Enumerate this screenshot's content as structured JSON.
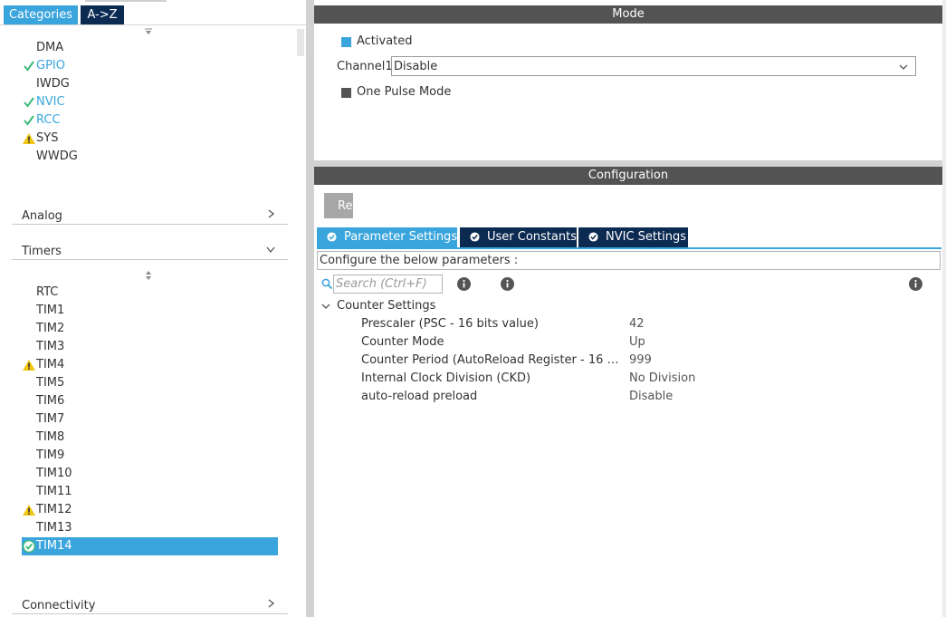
{
  "left": {
    "tabs": {
      "categories": "Categories",
      "az": "A->Z"
    },
    "system_items": [
      {
        "label": "DMA",
        "status": "none"
      },
      {
        "label": "GPIO",
        "status": "ok"
      },
      {
        "label": "IWDG",
        "status": "none"
      },
      {
        "label": "NVIC",
        "status": "ok"
      },
      {
        "label": "RCC",
        "status": "ok"
      },
      {
        "label": "SYS",
        "status": "warning"
      },
      {
        "label": "WWDG",
        "status": "none"
      }
    ],
    "sections": {
      "analog": "Analog",
      "timers": "Timers",
      "connectivity": "Connectivity"
    },
    "timer_items": [
      {
        "label": "RTC",
        "status": "none"
      },
      {
        "label": "TIM1",
        "status": "none"
      },
      {
        "label": "TIM2",
        "status": "none"
      },
      {
        "label": "TIM3",
        "status": "none"
      },
      {
        "label": "TIM4",
        "status": "warning"
      },
      {
        "label": "TIM5",
        "status": "none"
      },
      {
        "label": "TIM6",
        "status": "none"
      },
      {
        "label": "TIM7",
        "status": "none"
      },
      {
        "label": "TIM8",
        "status": "none"
      },
      {
        "label": "TIM9",
        "status": "none"
      },
      {
        "label": "TIM10",
        "status": "none"
      },
      {
        "label": "TIM11",
        "status": "none"
      },
      {
        "label": "TIM12",
        "status": "warning"
      },
      {
        "label": "TIM13",
        "status": "none"
      },
      {
        "label": "TIM14",
        "status": "selected-ok"
      }
    ]
  },
  "mode": {
    "header": "Mode",
    "activated_label": "Activated",
    "channel_label": "Channel1",
    "channel_value": "Disable",
    "one_pulse_label": "One Pulse Mode"
  },
  "config": {
    "header": "Configuration",
    "reset_button": "Re",
    "tabs": {
      "param": "Parameter Settings",
      "user": "User Constants",
      "nvic": "NVIC Settings"
    },
    "configure_label": "Configure the below parameters :",
    "search_placeholder": "Search (Ctrl+F)",
    "group_label": "Counter Settings",
    "params": [
      {
        "name": "Prescaler (PSC - 16 bits value)",
        "value": "42"
      },
      {
        "name": "Counter Mode",
        "value": "Up"
      },
      {
        "name": "Counter Period (AutoReload Register - 16 bits ...",
        "value": "999"
      },
      {
        "name": "Internal Clock Division (CKD)",
        "value": "No Division"
      },
      {
        "name": "auto-reload preload",
        "value": "Disable"
      }
    ]
  },
  "colors": {
    "accent": "#3aa5dc",
    "navy": "#0c2b52",
    "ok": "#3cb878",
    "warning": "#f2c511",
    "header_bar": "#535353"
  }
}
